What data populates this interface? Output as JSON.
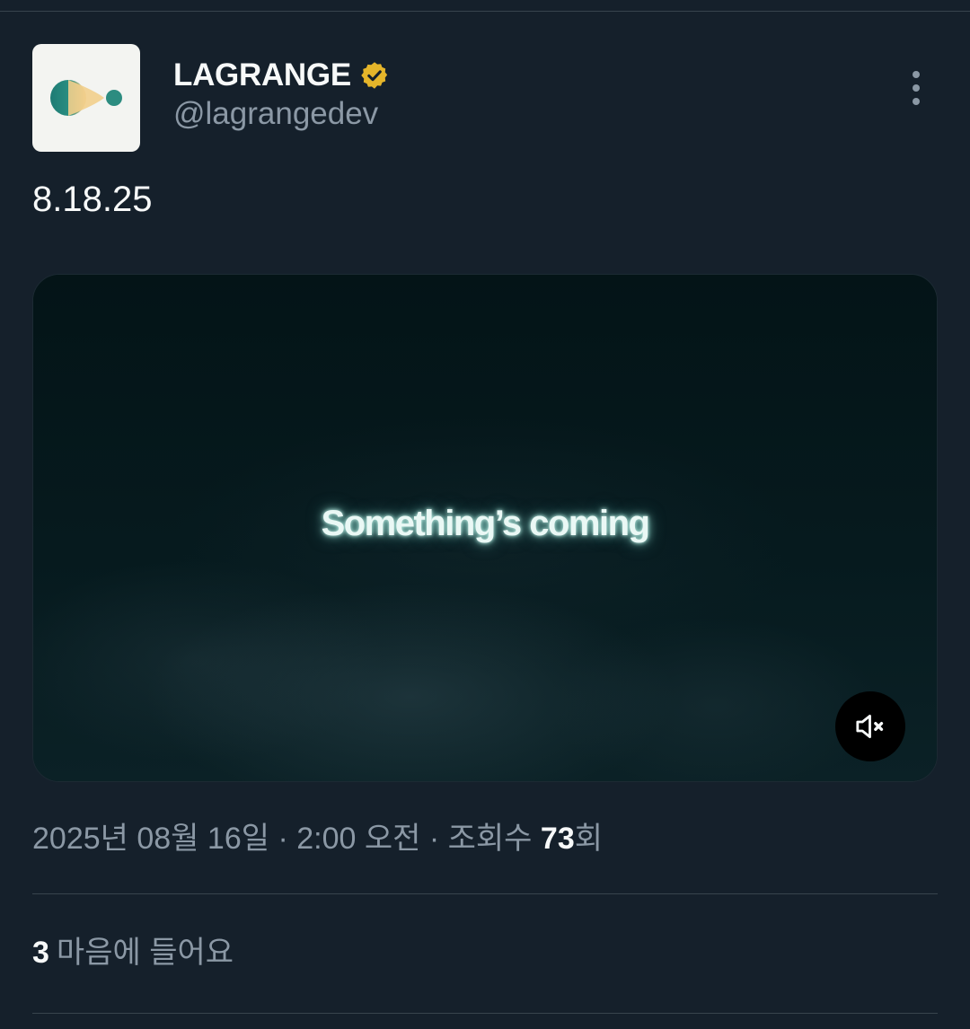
{
  "author": {
    "display_name": "LAGRANGE",
    "handle": "@lagrangedev",
    "verified": true,
    "verified_color": "#e5b52a",
    "avatar_icon": "lagrange-logo-icon"
  },
  "tweet": {
    "text": "8.18.25"
  },
  "media": {
    "caption": "Something’s coming",
    "mute_icon": "speaker-muted-icon"
  },
  "meta": {
    "timestamp": "2025년 08월 16일 · 2:00 오전 · 조회수 ",
    "views_count": "73",
    "views_suffix": "회"
  },
  "likes": {
    "count": "3",
    "label": "마음에 들어요"
  },
  "colors": {
    "background": "#15202b",
    "primary_text": "#f7f9f9",
    "secondary_text": "#8b98a5",
    "divider": "#38444d"
  },
  "icons": {
    "more": "more-vertical-icon",
    "verified": "verified-badge-icon"
  }
}
